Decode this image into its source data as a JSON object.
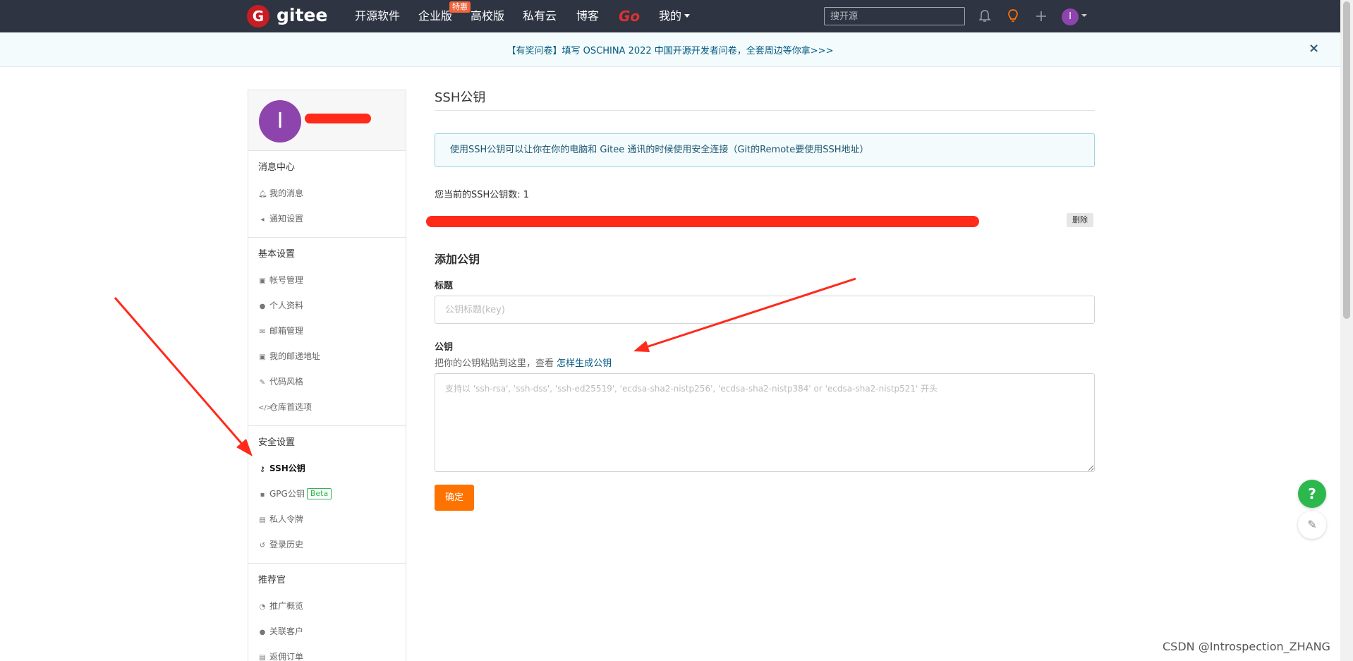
{
  "nav": {
    "logo_letter": "G",
    "logo_text": "gitee",
    "links": [
      "开源软件",
      "企业版",
      "高校版",
      "私有云",
      "博客",
      "Go",
      "我的"
    ],
    "badge": "特惠",
    "search_placeholder": "搜开源",
    "avatar_letter": "I",
    "icons": [
      "bell-icon",
      "bulb-icon",
      "plus-icon"
    ]
  },
  "banner": {
    "text": "【有奖问卷】填写 OSCHINA 2022 中国开源开发者问卷，全套周边等你拿>>>",
    "close": "×"
  },
  "sidebar": {
    "avatar_letter": "I",
    "groups": [
      {
        "title": "消息中心",
        "items": [
          {
            "label": "我的消息",
            "icon": "bell-icon"
          },
          {
            "label": "通知设置",
            "icon": "speaker-icon"
          }
        ]
      },
      {
        "title": "基本设置",
        "items": [
          {
            "label": "帐号管理",
            "icon": "id-card-icon"
          },
          {
            "label": "个人资料",
            "icon": "user-icon"
          },
          {
            "label": "邮箱管理",
            "icon": "mail-icon"
          },
          {
            "label": "我的邮递地址",
            "icon": "address-icon"
          },
          {
            "label": "代码风格",
            "icon": "brush-icon"
          },
          {
            "label": "仓库首选项",
            "icon": "code-icon"
          }
        ]
      },
      {
        "title": "安全设置",
        "items": [
          {
            "label": "SSH公钥",
            "icon": "key-icon"
          },
          {
            "label": "GPG公钥",
            "icon": "lock-icon",
            "badge": "Beta"
          },
          {
            "label": "私人令牌",
            "icon": "token-icon"
          },
          {
            "label": "登录历史",
            "icon": "history-icon"
          }
        ]
      },
      {
        "title": "推荐官",
        "items": [
          {
            "label": "推广概览",
            "icon": "chart-icon"
          },
          {
            "label": "关联客户",
            "icon": "user-link-icon"
          },
          {
            "label": "返佣订单",
            "icon": "order-icon"
          }
        ]
      }
    ]
  },
  "main": {
    "title": "SSH公钥",
    "info": "使用SSH公钥可以让你在你的电脑和 Gitee 通讯的时候使用安全连接（Git的Remote要使用SSH地址）",
    "count": "您当前的SSH公钥数: 1",
    "delete_label": "删除",
    "add_title": "添加公钥",
    "title_label": "标题",
    "title_placeholder": "公钥标题(key)",
    "key_label": "公钥",
    "key_hint": "把你的公钥粘贴到这里，查看 ",
    "key_hint_link": "怎样生成公钥",
    "key_placeholder": "支持以 'ssh-rsa', 'ssh-dss', 'ssh-ed25519', 'ecdsa-sha2-nistp256', 'ecdsa-sha2-nistp384' or 'ecdsa-sha2-nistp521' 开头",
    "submit": "确定"
  },
  "float": {
    "help": "?",
    "edit": "✎"
  },
  "watermark": "CSDN @Introspection_ZHANG",
  "colors": {
    "nav_bg": "#2e3442",
    "brand": "#c71d23",
    "submit": "#fe7300",
    "annotation": "#ff2a1a"
  }
}
